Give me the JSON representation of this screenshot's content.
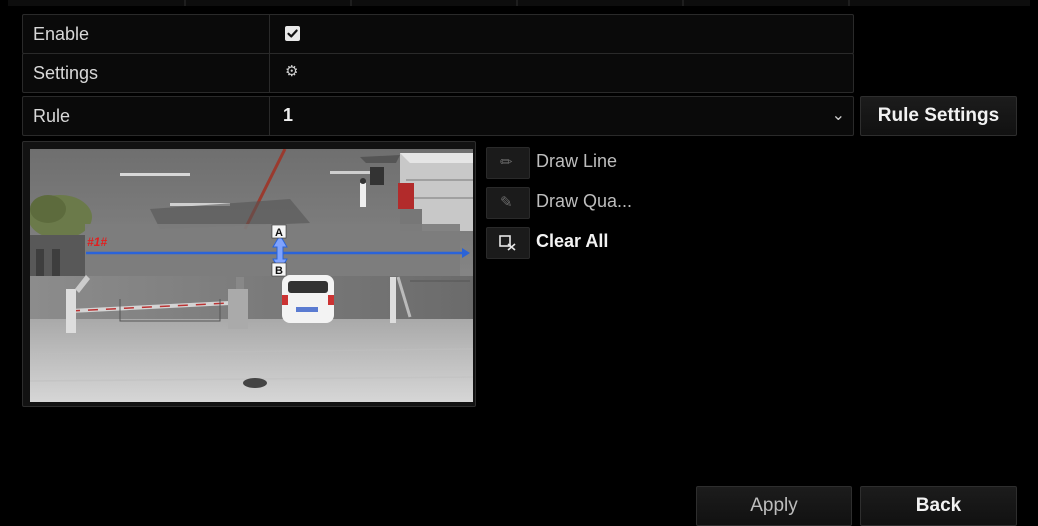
{
  "form": {
    "enable_label": "Enable",
    "enable_checked": true,
    "settings_label": "Settings",
    "rule_label": "Rule",
    "rule_value": "1"
  },
  "buttons": {
    "rule_settings": "Rule Settings",
    "apply": "Apply",
    "back": "Back"
  },
  "tools": [
    {
      "label": "Draw Line",
      "icon": "pencil-icon",
      "enabled": false
    },
    {
      "label": "Draw Qua...",
      "icon": "edit-box-icon",
      "enabled": false
    },
    {
      "label": "Clear All",
      "icon": "clear-icon",
      "enabled": true
    }
  ],
  "preview": {
    "rule_tag": "#1#",
    "side_a": "A",
    "side_b": "B"
  },
  "colors": {
    "enabled_text": "#f2f2f2",
    "disabled_text": "#bdbdbd",
    "rule_tag": "#e02020",
    "line_blue": "#2a63d8"
  }
}
